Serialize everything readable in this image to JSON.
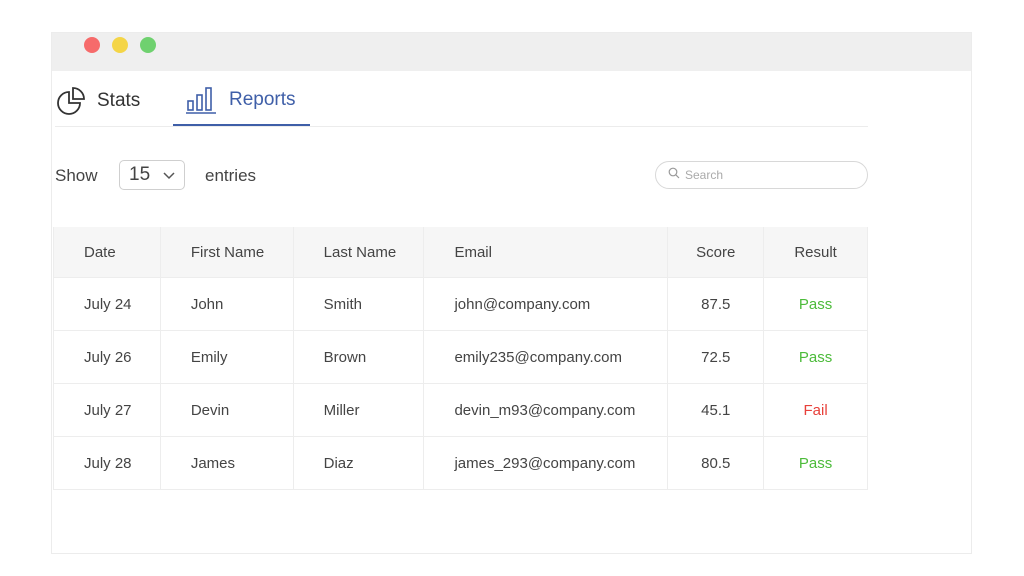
{
  "window": {
    "controls": [
      "close",
      "minimize",
      "maximize"
    ]
  },
  "tabs": [
    {
      "label": "Stats",
      "icon": "pie-chart-icon",
      "active": false
    },
    {
      "label": "Reports",
      "icon": "bar-chart-icon",
      "active": true
    }
  ],
  "controls": {
    "show_label": "Show",
    "entries_value": "15",
    "entries_label": "entries",
    "search_placeholder": "Search"
  },
  "table": {
    "headers": [
      "Date",
      "First Name",
      "Last Name",
      "Email",
      "Score",
      "Result"
    ],
    "rows": [
      {
        "date": "July 24",
        "first": "John",
        "last": "Smith",
        "email": "john@company.com",
        "score": "87.5",
        "result": "Pass"
      },
      {
        "date": "July 26",
        "first": "Emily",
        "last": "Brown",
        "email": "emily235@company.com",
        "score": "72.5",
        "result": "Pass"
      },
      {
        "date": "July 27",
        "first": "Devin",
        "last": "Miller",
        "email": "devin_m93@company.com",
        "score": "45.1",
        "result": "Fail"
      },
      {
        "date": "July 28",
        "first": "James",
        "last": "Diaz",
        "email": "james_293@company.com",
        "score": "80.5",
        "result": "Pass"
      }
    ]
  },
  "colors": {
    "accent": "#3f5fa8",
    "pass": "#4cbb3a",
    "fail": "#e8403a"
  }
}
